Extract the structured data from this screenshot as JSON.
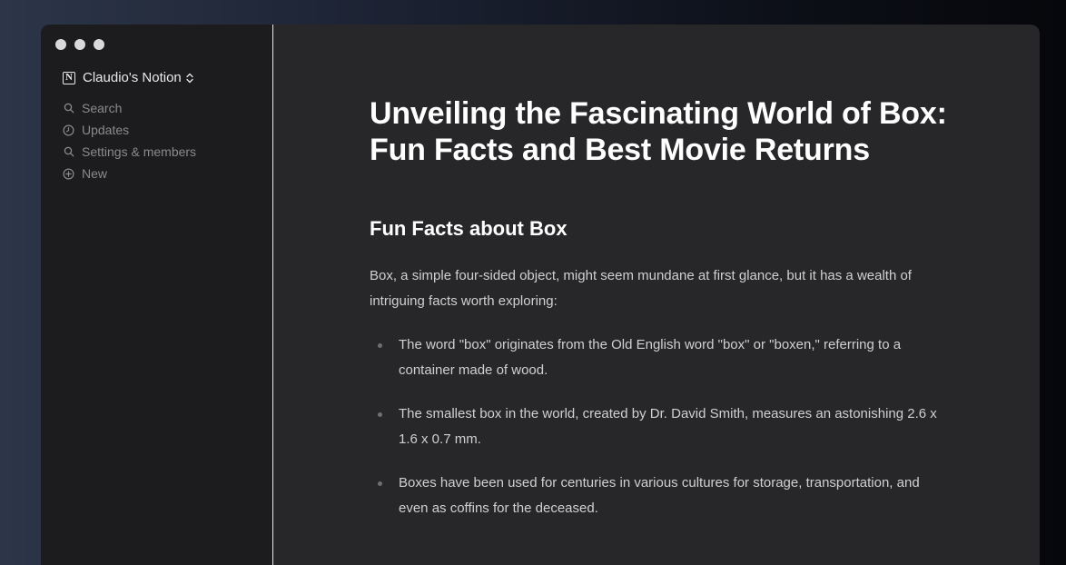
{
  "sidebar": {
    "workspace_name": "Claudio's Notion",
    "workspace_icon": "notion-logo-icon",
    "items": [
      {
        "label": "Search",
        "icon": "search-icon"
      },
      {
        "label": "Updates",
        "icon": "clock-icon"
      },
      {
        "label": "Settings & members",
        "icon": "search-icon"
      },
      {
        "label": "New",
        "icon": "plus-circle-icon"
      }
    ]
  },
  "page": {
    "title": "Unveiling the Fascinating World of Box: Fun Facts and Best Movie Returns",
    "section_heading": "Fun Facts about Box",
    "intro": "Box, a simple four-sided object, might seem mundane at first glance, but it has a wealth of intriguing facts worth exploring:",
    "facts": [
      "The word \"box\" originates from the Old English word \"box\" or \"boxen,\" referring to a container made of wood.",
      "The smallest box in the world, created by Dr. David Smith, measures an astonishing 2.6 x 1.6 x 0.7 mm.",
      "Boxes have been used for centuries in various cultures for storage, transportation, and even as coffins for the deceased."
    ]
  },
  "colors": {
    "sidebar_bg": "#1c1c1e",
    "content_bg": "#27272a",
    "text_primary": "#ffffff",
    "text_muted": "#8a8a8e"
  }
}
